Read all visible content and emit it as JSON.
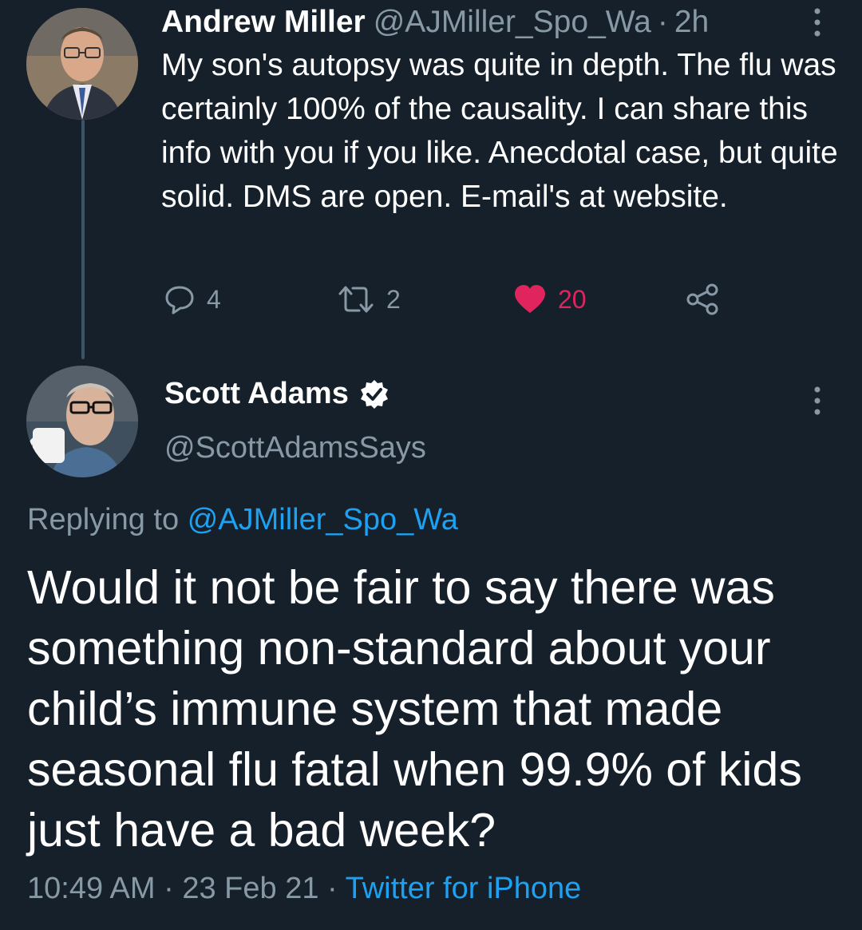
{
  "tweet1": {
    "display_name": "Andrew Miller",
    "handle": "@AJMiller_Spo_Wa",
    "time_sep": "·",
    "time": "2h",
    "text": "My son's autopsy was quite in depth. The flu was certainly 100% of the causality. I can share this info with you if you like. Anecdotal case, but quite solid. DMS are open. E-mail's at website.",
    "replies": "4",
    "retweets": "2",
    "likes": "20",
    "liked": true
  },
  "tweet2": {
    "display_name": "Scott Adams",
    "verified": true,
    "handle": "@ScottAdamsSays",
    "replying_label": "Replying to",
    "replying_to": "@AJMiller_Spo_Wa",
    "text": "Would it not be fair to say there was something non-standard about your child’s immune system that made seasonal flu fatal when 99.9% of kids just have a bad week?",
    "time": "10:49 AM",
    "sep1": "·",
    "date": "23 Feb 21",
    "sep2": "·",
    "source": "Twitter for iPhone"
  },
  "colors": {
    "background": "#15202b",
    "text_primary": "#ffffff",
    "text_secondary": "#8899a6",
    "accent": "#1da1f2",
    "like": "#e0245e",
    "thread_line": "#3d5466"
  },
  "icons": [
    "reply-icon",
    "retweet-icon",
    "like-icon",
    "share-icon",
    "more-icon",
    "verified-badge-icon"
  ]
}
